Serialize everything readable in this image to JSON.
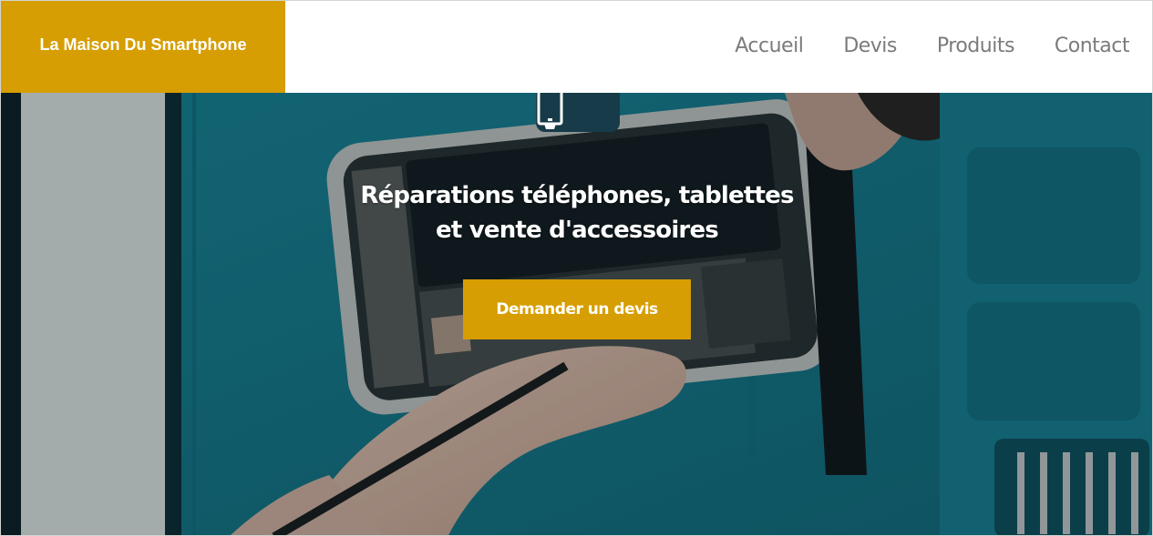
{
  "brand": {
    "name": "La Maison Du Smartphone",
    "accent_color": "#d69e02"
  },
  "nav": {
    "items": [
      {
        "label": "Accueil"
      },
      {
        "label": "Devis"
      },
      {
        "label": "Produits"
      },
      {
        "label": "Contact"
      }
    ]
  },
  "hero": {
    "title_line1": "Réparations téléphones, tablettes",
    "title_line2": "et vente d'accessoires",
    "cta_label": "Demander un devis",
    "icon": "smartphone-icon",
    "background": "phone-repair-photo"
  }
}
